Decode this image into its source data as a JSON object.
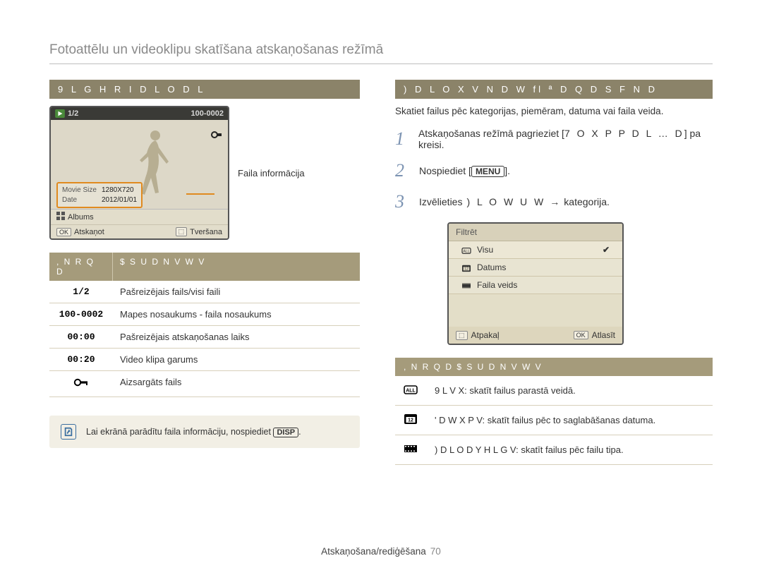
{
  "page_title": "Fotoattēlu un videoklipu skatīšana atskaņošanas režīmā",
  "left": {
    "section_header": "9 L G H R   I D L O D   L",
    "preview": {
      "counter": "1/2",
      "filecode": "100-0002",
      "info": {
        "size_label": "Movie Size",
        "size_value": "1280X720",
        "date_label": "Date",
        "date_value": "2012/01/01"
      },
      "album_label": "Albums",
      "ok_label": "OK",
      "play_label": "Atskaņot",
      "capture_btn": "⬚",
      "capture_label": "Tveršana",
      "caption": "Faila informācija"
    },
    "table_head_icon": ", N R Q D",
    "table_head_desc": "$ S U D N V W V",
    "rows": [
      {
        "icon": "1/2",
        "desc": "Pašreizējais fails/visi faili"
      },
      {
        "icon": "100-0002",
        "desc": "Mapes nosaukums - faila nosaukums"
      },
      {
        "icon": "00:00",
        "desc": "Pašreizējais atskaņošanas laiks"
      },
      {
        "icon": "00:20",
        "desc": "Video klipa garums"
      },
      {
        "icon": "key",
        "desc": "Aizsargāts fails"
      }
    ],
    "note_text": "Lai ekrānā parādītu faila informāciju, nospiediet ",
    "note_btn": "DISP"
  },
  "right": {
    "section_header": ") D L O X   V N D W fl ª D Q D   S   F   N D",
    "intro": "Skatiet failus pēc kategorijas, piemēram, datuma vai faila veida.",
    "steps": [
      {
        "n": "1",
        "pre": "Atskaņošanas režīmā pagrieziet [",
        "mid": "7   O X P P D L … D",
        "post": "] pa kreisi."
      },
      {
        "n": "2",
        "pre": "Nospiediet [",
        "btn": "MENU",
        "post": "]."
      },
      {
        "n": "3",
        "pre": "Izvēlieties ",
        "mid": ") L O W U   W",
        "arrow": "→",
        "post": " kategorija."
      }
    ],
    "filter_panel": {
      "title": "Filtrēt",
      "items": [
        {
          "icon": "all",
          "label": "Visu",
          "selected": true
        },
        {
          "icon": "cal",
          "label": "Datums"
        },
        {
          "icon": "film",
          "label": "Faila veids"
        }
      ],
      "back_btn": "⬚",
      "back_label": "Atpakaļ",
      "ok_btn": "OK",
      "select_label": "Atlasīt"
    },
    "table_head": ", N R Q D $ S U D N V W V",
    "rows": [
      {
        "icon": "all",
        "desc": "9 L V X: skatīt failus parastā veidā."
      },
      {
        "icon": "cal",
        "desc": "' D W X P V: skatīt failus pēc to saglabāšanas datuma."
      },
      {
        "icon": "film",
        "desc": ") D L O D   Y H L G V: skatīt failus pēc failu tipa."
      }
    ]
  },
  "footer": {
    "section": "Atskaņošana/rediģēšana",
    "page": "70"
  }
}
